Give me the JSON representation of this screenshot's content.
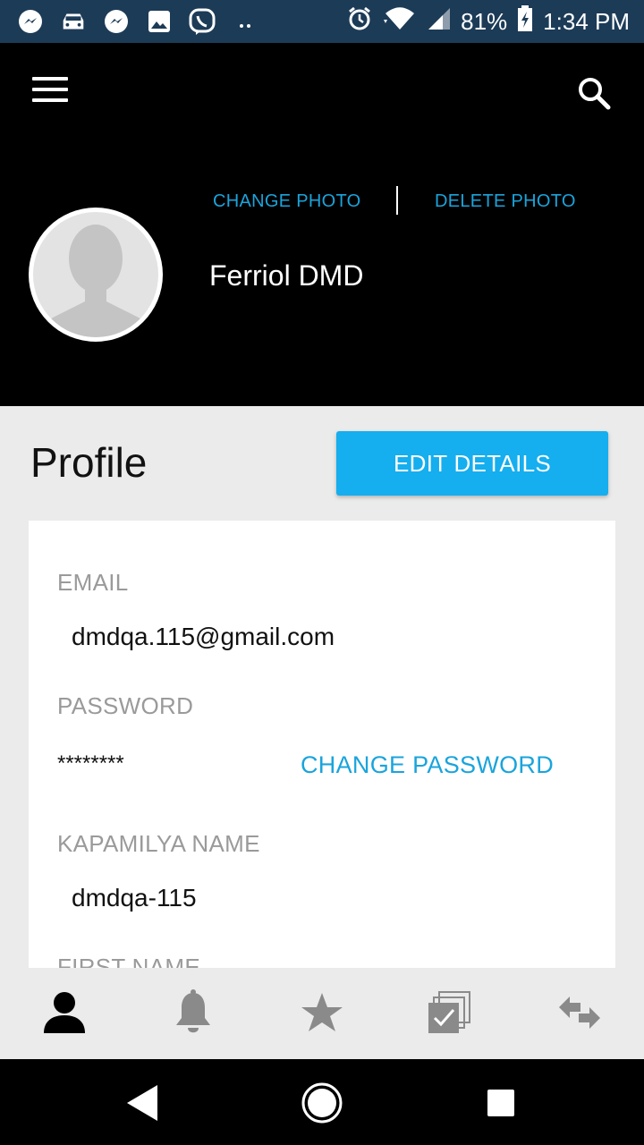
{
  "status_bar": {
    "left_icons": [
      "messenger-icon",
      "car-icon",
      "messenger-icon",
      "gallery-icon",
      "viber-icon",
      "more-dots-icon"
    ],
    "battery_percent": "81%",
    "time": "1:34 PM"
  },
  "header": {
    "change_photo": "CHANGE PHOTO",
    "delete_photo": "DELETE PHOTO",
    "name": "Ferriol DMD"
  },
  "profile": {
    "title": "Profile",
    "edit_button": "EDIT DETAILS",
    "fields": {
      "email_label": "EMAIL",
      "email_value": "dmdqa.115@gmail.com",
      "password_label": "PASSWORD",
      "password_value": "********",
      "change_password": "CHANGE PASSWORD",
      "kapamilya_label": "KAPAMILYA NAME",
      "kapamilya_value": "dmdqa-115",
      "first_name_label": "FIRST NAME"
    }
  },
  "bottom_nav": {
    "items": [
      "profile-icon",
      "bell-icon",
      "star-icon",
      "tasks-icon",
      "transfer-icon"
    ],
    "active": "profile-icon"
  },
  "colors": {
    "status_bar": "#1c3b57",
    "accent": "#15aeef",
    "link": "#1aa4dc",
    "header_bg": "#000000"
  }
}
